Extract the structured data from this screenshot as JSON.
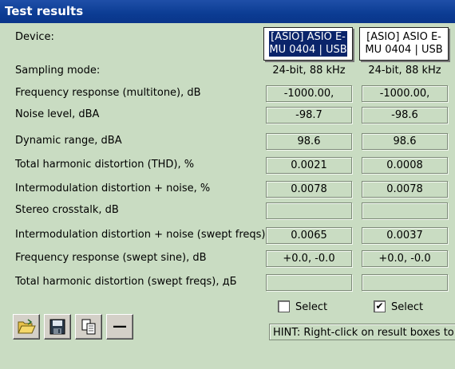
{
  "window": {
    "title": "Test results"
  },
  "device": {
    "label": "Device:",
    "col1": "[ASIO] ASIO E-MU 0404 | USB",
    "col2": "[ASIO] ASIO E-MU 0404 | USB"
  },
  "sampling": {
    "label": "Sampling mode:",
    "col1": "24-bit, 88 kHz",
    "col2": "24-bit, 88 kHz"
  },
  "rows": [
    {
      "label": "Frequency response (multitone), dB",
      "col1": "-1000.00,",
      "col2": "-1000.00,"
    },
    {
      "label": "Noise level, dBA",
      "col1": "-98.7",
      "col2": "-98.6"
    },
    {
      "label": "Dynamic range, dBA",
      "col1": "98.6",
      "col2": "98.6"
    },
    {
      "label": "Total harmonic distortion (THD), %",
      "col1": "0.0021",
      "col2": "0.0008"
    },
    {
      "label": "Intermodulation distortion + noise, %",
      "col1": "0.0078",
      "col2": "0.0078"
    },
    {
      "label": "Stereo crosstalk, dB",
      "col1": "",
      "col2": ""
    },
    {
      "label": "Intermodulation distortion + noise (swept freqs),",
      "col1": "0.0065",
      "col2": "0.0037"
    },
    {
      "label": "Frequency response (swept sine), dB",
      "col1": "+0.0, -0.0",
      "col2": "+0.0, -0.0"
    },
    {
      "label": "Total harmonic distortion (swept freqs), дБ",
      "col1": "",
      "col2": ""
    }
  ],
  "select": {
    "label1": "Select",
    "label2": "Select",
    "checked1": false,
    "checked2": true,
    "checkmark": "✔"
  },
  "toolbar": {
    "icons": [
      "open-folder-icon",
      "save-icon",
      "copy-icon",
      "minus-icon"
    ],
    "minus_glyph": "—"
  },
  "hint": "HINT: Right-click on result boxes to view"
}
